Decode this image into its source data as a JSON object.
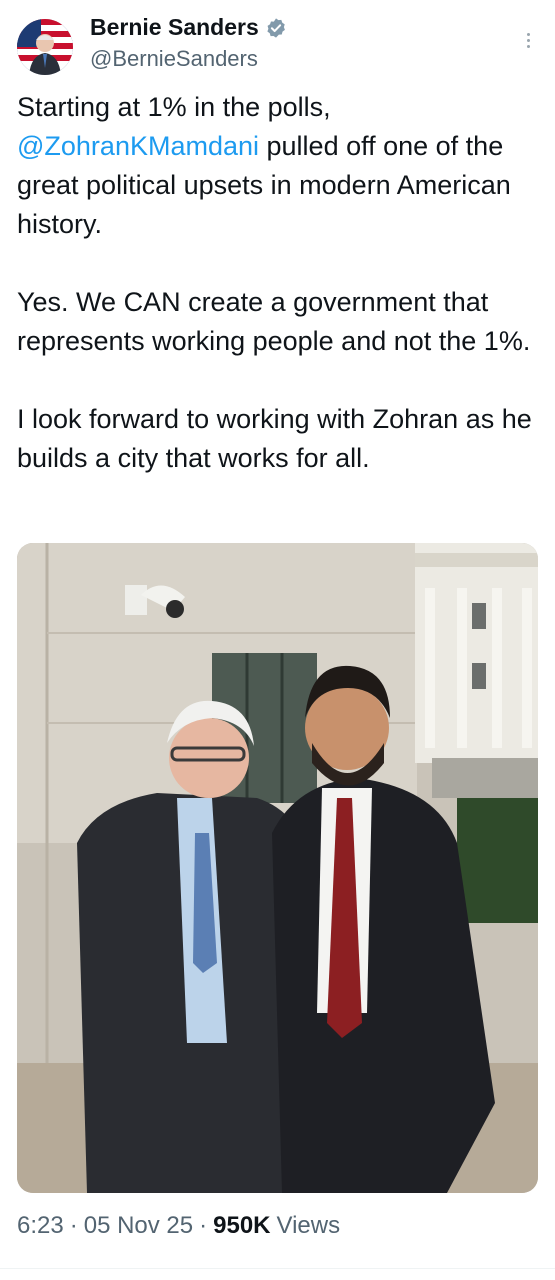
{
  "author": {
    "name": "Bernie Sanders",
    "handle": "@BernieSanders",
    "verified_icon": "verified-badge-icon",
    "avatar_icon": "avatar-flag-portrait"
  },
  "tweet": {
    "p1_before": "Starting at 1% in the polls, ",
    "p1_mention": "@ZohranKMamdani",
    "p1_after": " pulled off one of the great political upsets in modern American history.",
    "p2": "Yes. We CAN create a government that represents working people and not the 1%.",
    "p3": "I look forward to working with Zohran as he builds a city that works for all."
  },
  "meta": {
    "time": "6:23",
    "sep1": "·",
    "date": "05 Nov 25",
    "sep2": "·",
    "views_count": "950K",
    "views_label": "Views"
  },
  "colors": {
    "link": "#1d9bf0",
    "muted": "#536471",
    "verified": "#829aab"
  }
}
